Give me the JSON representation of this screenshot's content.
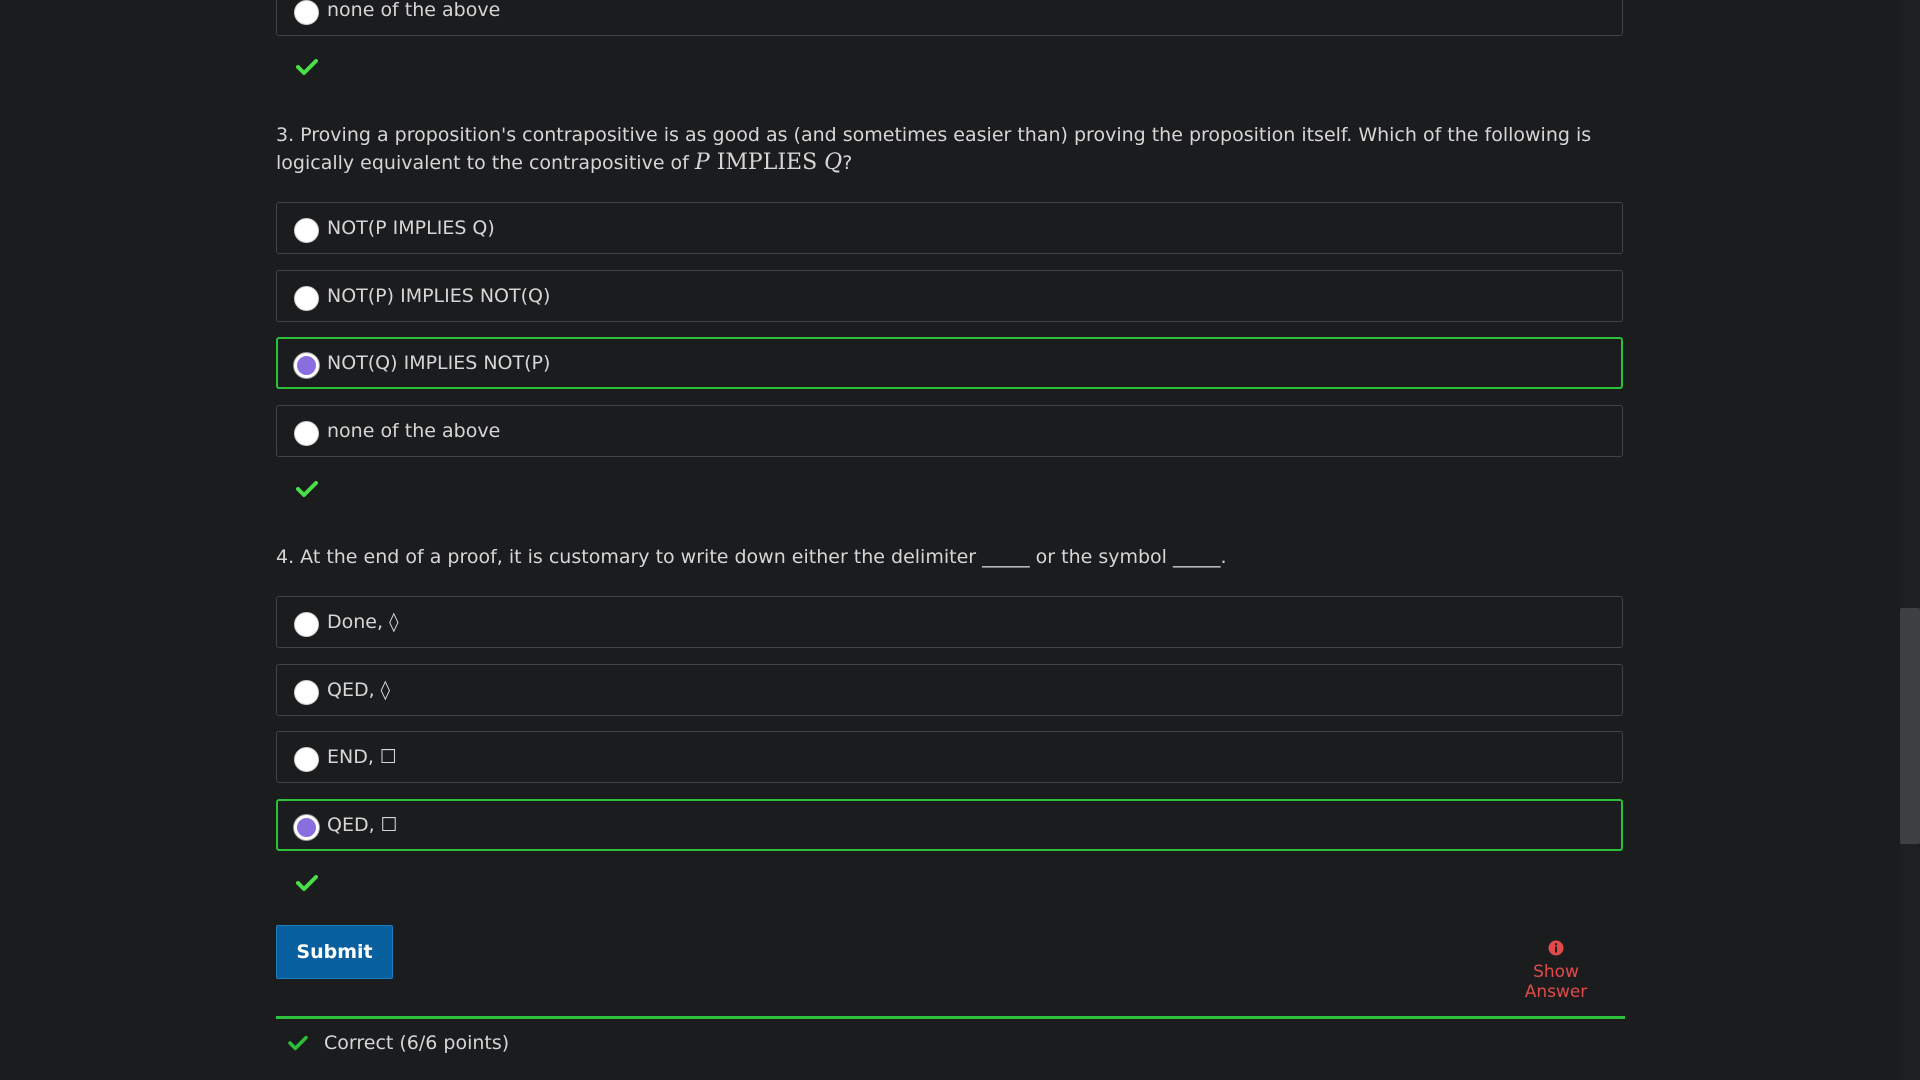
{
  "q2": {
    "option_4": "none of the above"
  },
  "q3": {
    "text_prefix": "3. Proving a proposition's contrapositive is as good as (and sometimes easier than) proving the proposition itself. Which of the following is logically equivalent to the contrapositive of ",
    "math_p": "P",
    "math_op": "IMPLIES",
    "math_q": "Q",
    "text_suffix": "?",
    "options": [
      "NOT(P IMPLIES Q)",
      "NOT(P) IMPLIES NOT(Q)",
      "NOT(Q) IMPLIES NOT(P)",
      "none of the above"
    ],
    "selected_index": 2
  },
  "q4": {
    "text": "4. At the end of a proof, it is customary to write down either the delimiter _____ or the symbol _____.",
    "options": [
      "Done, ◊",
      "QED, ◊",
      "END, ☐",
      "QED, ☐"
    ],
    "selected_index": 3
  },
  "actions": {
    "submit_label": "Submit",
    "show_answer_label": "Show Answer"
  },
  "status": {
    "text": "Correct (6/6 points)"
  },
  "colors": {
    "correct_green": "#2bbf3a",
    "check_green": "#4ade4a",
    "selected_radio": "#8a6ee0",
    "submit_blue": "#075f9e",
    "show_answer_red": "#e24a4a"
  },
  "icons": {
    "check": "check-icon",
    "info": "info-icon"
  }
}
